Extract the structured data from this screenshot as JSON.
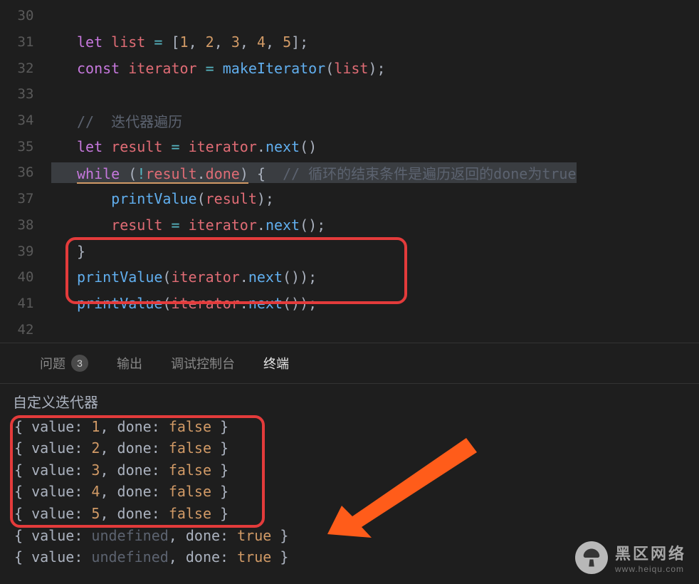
{
  "editor": {
    "first_line_number": 30,
    "lines": [
      {
        "n": 30,
        "tokens": []
      },
      {
        "n": 31,
        "tokens": [
          [
            "kw",
            "let"
          ],
          [
            "plain",
            " "
          ],
          [
            "var",
            "list"
          ],
          [
            "plain",
            " "
          ],
          [
            "op",
            "="
          ],
          [
            "plain",
            " "
          ],
          [
            "punct",
            "["
          ],
          [
            "num",
            "1"
          ],
          [
            "punct",
            ", "
          ],
          [
            "num",
            "2"
          ],
          [
            "punct",
            ", "
          ],
          [
            "num",
            "3"
          ],
          [
            "punct",
            ", "
          ],
          [
            "num",
            "4"
          ],
          [
            "punct",
            ", "
          ],
          [
            "num",
            "5"
          ],
          [
            "punct",
            "];"
          ]
        ]
      },
      {
        "n": 32,
        "tokens": [
          [
            "kw",
            "const"
          ],
          [
            "plain",
            " "
          ],
          [
            "var",
            "iterator"
          ],
          [
            "plain",
            " "
          ],
          [
            "op",
            "="
          ],
          [
            "plain",
            " "
          ],
          [
            "fn",
            "makeIterator"
          ],
          [
            "punct",
            "("
          ],
          [
            "var",
            "list"
          ],
          [
            "punct",
            ");"
          ]
        ]
      },
      {
        "n": 33,
        "tokens": []
      },
      {
        "n": 34,
        "tokens": [
          [
            "comment",
            "//  迭代器遍历"
          ]
        ]
      },
      {
        "n": 35,
        "tokens": [
          [
            "kw",
            "let"
          ],
          [
            "plain",
            " "
          ],
          [
            "var",
            "result"
          ],
          [
            "plain",
            " "
          ],
          [
            "op",
            "="
          ],
          [
            "plain",
            " "
          ],
          [
            "var",
            "iterator"
          ],
          [
            "punct",
            "."
          ],
          [
            "fn",
            "next"
          ],
          [
            "punct",
            "()"
          ]
        ]
      },
      {
        "n": 36,
        "hl": true,
        "tokens": [
          [
            "whilehl kw",
            "while"
          ],
          [
            "whilehl plain",
            " "
          ],
          [
            "whilehl punct",
            "("
          ],
          [
            "whilehl op",
            "!"
          ],
          [
            "whilehl var",
            "result"
          ],
          [
            "whilehl punct",
            "."
          ],
          [
            "whilehl prop",
            "done"
          ],
          [
            "whilehl punct",
            ")"
          ],
          [
            "plain",
            " "
          ],
          [
            "punct",
            "{"
          ],
          [
            "plain",
            "  "
          ],
          [
            "comment",
            "// 循环的结束条件是遍历返回的done为true"
          ]
        ]
      },
      {
        "n": 37,
        "indent": 1,
        "tokens": [
          [
            "fn",
            "printValue"
          ],
          [
            "punct",
            "("
          ],
          [
            "var",
            "result"
          ],
          [
            "punct",
            ");"
          ]
        ]
      },
      {
        "n": 38,
        "indent": 1,
        "tokens": [
          [
            "var",
            "result"
          ],
          [
            "plain",
            " "
          ],
          [
            "op",
            "="
          ],
          [
            "plain",
            " "
          ],
          [
            "var",
            "iterator"
          ],
          [
            "punct",
            "."
          ],
          [
            "fn",
            "next"
          ],
          [
            "punct",
            "();"
          ]
        ]
      },
      {
        "n": 39,
        "tokens": [
          [
            "punct",
            "}"
          ]
        ]
      },
      {
        "n": 40,
        "tokens": [
          [
            "fn",
            "printValue"
          ],
          [
            "punct",
            "("
          ],
          [
            "var",
            "iterator"
          ],
          [
            "punct",
            "."
          ],
          [
            "fn",
            "next"
          ],
          [
            "punct",
            "());"
          ]
        ]
      },
      {
        "n": 41,
        "tokens": [
          [
            "fn",
            "printValue"
          ],
          [
            "punct",
            "("
          ],
          [
            "var",
            "iterator"
          ],
          [
            "punct",
            "."
          ],
          [
            "fn",
            "next"
          ],
          [
            "punct",
            "());"
          ]
        ]
      },
      {
        "n": 42,
        "tokens": []
      }
    ]
  },
  "panel": {
    "tabs": {
      "problems_label": "问题",
      "problems_count": "3",
      "output_label": "输出",
      "debug_label": "调试控制台",
      "terminal_label": "终端",
      "active": "terminal"
    }
  },
  "terminal": {
    "title": "自定义迭代器",
    "lines": [
      [
        [
          "punct",
          "{ "
        ],
        [
          "plain",
          "value"
        ],
        [
          "punct",
          ": "
        ],
        [
          "num",
          "1"
        ],
        [
          "punct",
          ", "
        ],
        [
          "plain",
          "done"
        ],
        [
          "punct",
          ": "
        ],
        [
          "bool",
          "false"
        ],
        [
          "punct",
          " }"
        ]
      ],
      [
        [
          "punct",
          "{ "
        ],
        [
          "plain",
          "value"
        ],
        [
          "punct",
          ": "
        ],
        [
          "num",
          "2"
        ],
        [
          "punct",
          ", "
        ],
        [
          "plain",
          "done"
        ],
        [
          "punct",
          ": "
        ],
        [
          "bool",
          "false"
        ],
        [
          "punct",
          " }"
        ]
      ],
      [
        [
          "punct",
          "{ "
        ],
        [
          "plain",
          "value"
        ],
        [
          "punct",
          ": "
        ],
        [
          "num",
          "3"
        ],
        [
          "punct",
          ", "
        ],
        [
          "plain",
          "done"
        ],
        [
          "punct",
          ": "
        ],
        [
          "bool",
          "false"
        ],
        [
          "punct",
          " }"
        ]
      ],
      [
        [
          "punct",
          "{ "
        ],
        [
          "plain",
          "value"
        ],
        [
          "punct",
          ": "
        ],
        [
          "num",
          "4"
        ],
        [
          "punct",
          ", "
        ],
        [
          "plain",
          "done"
        ],
        [
          "punct",
          ": "
        ],
        [
          "bool",
          "false"
        ],
        [
          "punct",
          " }"
        ]
      ],
      [
        [
          "punct",
          "{ "
        ],
        [
          "plain",
          "value"
        ],
        [
          "punct",
          ": "
        ],
        [
          "num",
          "5"
        ],
        [
          "punct",
          ", "
        ],
        [
          "plain",
          "done"
        ],
        [
          "punct",
          ": "
        ],
        [
          "bool",
          "false"
        ],
        [
          "punct",
          " }"
        ]
      ],
      [
        [
          "punct",
          "{ "
        ],
        [
          "plain",
          "value"
        ],
        [
          "punct",
          ": "
        ],
        [
          "undef",
          "undefined"
        ],
        [
          "punct",
          ", "
        ],
        [
          "plain",
          "done"
        ],
        [
          "punct",
          ": "
        ],
        [
          "bool",
          "true"
        ],
        [
          "punct",
          " }"
        ]
      ],
      [
        [
          "punct",
          "{ "
        ],
        [
          "plain",
          "value"
        ],
        [
          "punct",
          ": "
        ],
        [
          "undef",
          "undefined"
        ],
        [
          "punct",
          ", "
        ],
        [
          "plain",
          "done"
        ],
        [
          "punct",
          ": "
        ],
        [
          "bool",
          "true"
        ],
        [
          "punct",
          " }"
        ]
      ]
    ]
  },
  "watermark": {
    "title": "黑区网络",
    "url": "www.heiqu.com"
  }
}
